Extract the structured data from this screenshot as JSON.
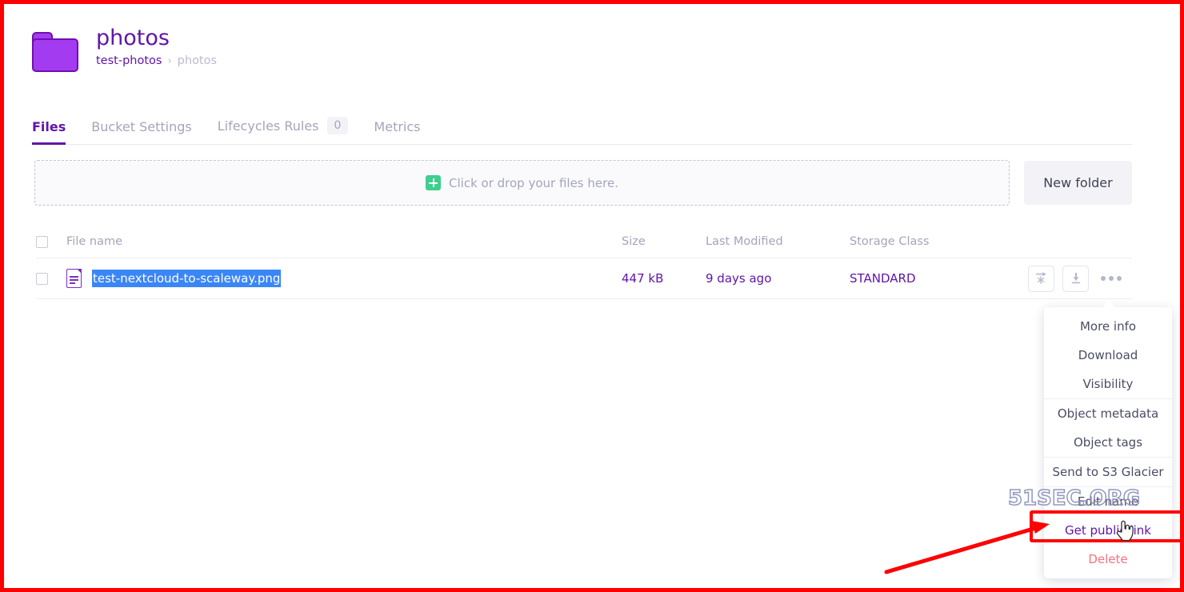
{
  "header": {
    "folder_icon": "folder-icon",
    "title": "photos",
    "breadcrumb": {
      "root": "test-photos",
      "separator": "›",
      "current": "photos"
    }
  },
  "tabs": [
    {
      "label": "Files",
      "active": true,
      "badge": null
    },
    {
      "label": "Bucket Settings",
      "active": false,
      "badge": null
    },
    {
      "label": "Lifecycles Rules",
      "active": false,
      "badge": "0"
    },
    {
      "label": "Metrics",
      "active": false,
      "badge": null
    }
  ],
  "upload": {
    "dropzone_label": "Click or drop your files here.",
    "plus_icon": "plus-icon",
    "new_folder_label": "New folder"
  },
  "table": {
    "columns": {
      "file_name": "File name",
      "size": "Size",
      "last_modified": "Last Modified",
      "storage_class": "Storage Class"
    },
    "rows": [
      {
        "file_name": "test-nextcloud-to-scaleway.png",
        "size": "447 kB",
        "last_modified": "9 days ago",
        "storage_class": "STANDARD",
        "selected_text": true,
        "actions": {
          "glacier_icon": "send-to-glacier-icon",
          "download_icon": "download-icon",
          "kebab_icon": "more-options-icon"
        }
      }
    ]
  },
  "context_menu": {
    "items": [
      {
        "label": "More info",
        "style": "normal",
        "divider_above": false
      },
      {
        "label": "Download",
        "style": "normal",
        "divider_above": false
      },
      {
        "label": "Visibility",
        "style": "normal",
        "divider_above": false
      },
      {
        "label": "Object metadata",
        "style": "normal",
        "divider_above": true
      },
      {
        "label": "Object tags",
        "style": "normal",
        "divider_above": false
      },
      {
        "label": "Send to S3 Glacier",
        "style": "normal",
        "divider_above": true
      },
      {
        "label": "Edit name",
        "style": "normal",
        "divider_above": true
      },
      {
        "label": "Get public link",
        "style": "highlight",
        "divider_above": false
      },
      {
        "label": "Delete",
        "style": "danger",
        "divider_above": false
      }
    ]
  },
  "annotations": {
    "highlight_box_color": "#ff0000",
    "arrow_color": "#ff0000",
    "frame_color": "#ff0000",
    "watermark_text": "51SEC.ORG",
    "cursor_icon": "pointer-hand-cursor"
  },
  "colors": {
    "brand_purple": "#6116a8",
    "folder_purple": "#a33bf0",
    "accent_green": "#3ecf8e",
    "selection_blue": "#3b86f7",
    "danger_red": "#f9707f",
    "muted_gray": "#a3a6bb"
  }
}
